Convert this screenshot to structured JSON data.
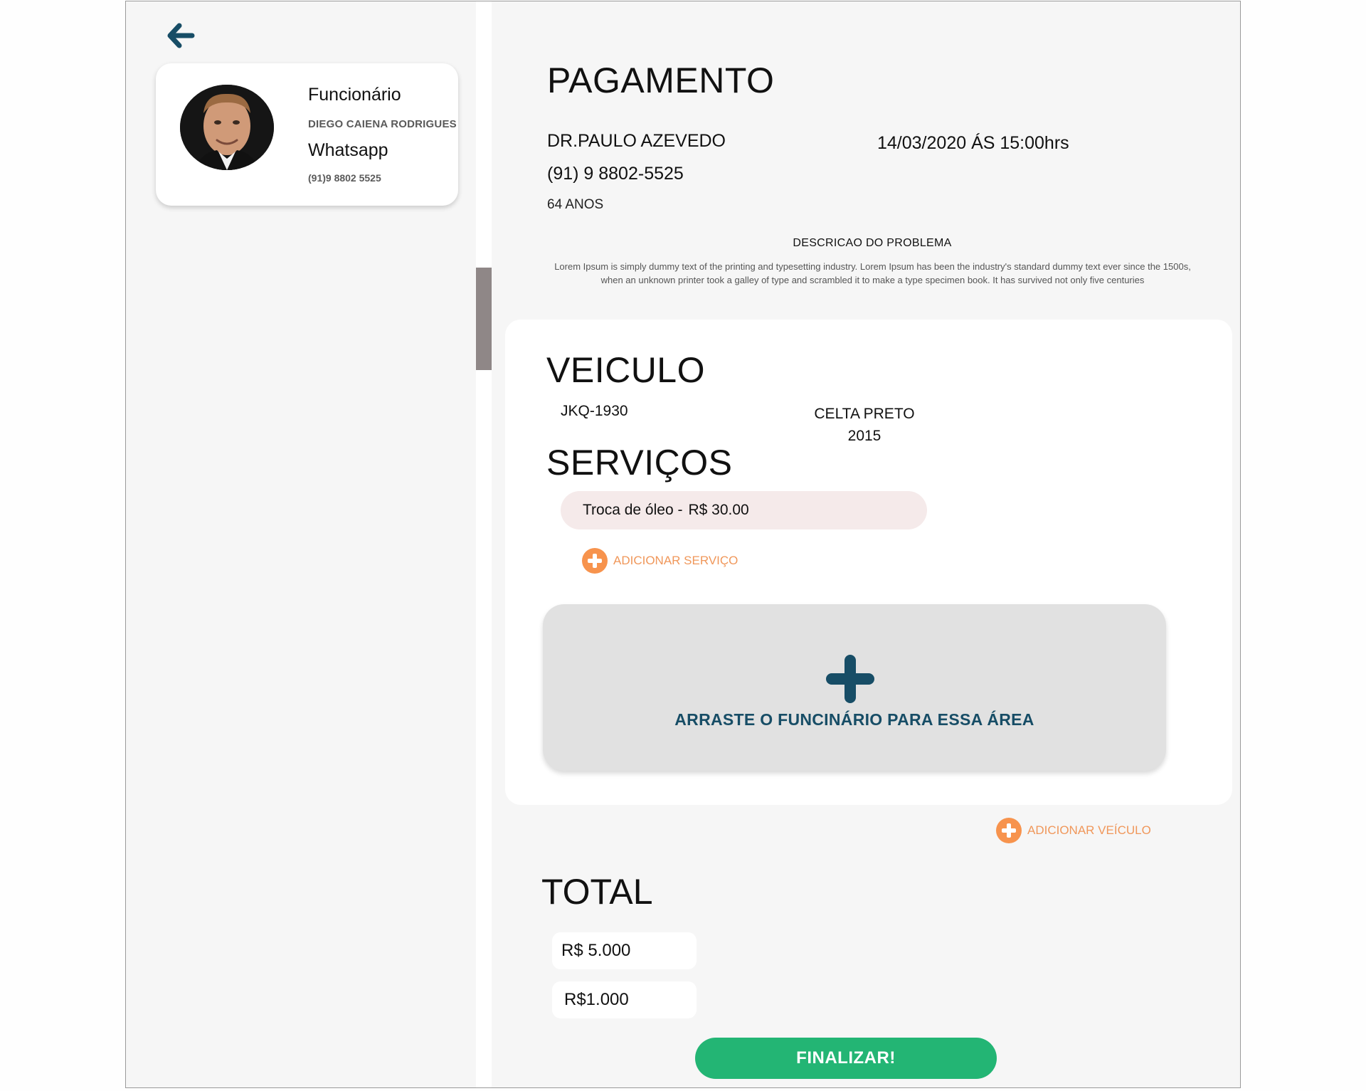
{
  "sidebar": {
    "back_icon": "arrow-left-icon",
    "employee": {
      "role_label": "Funcionário",
      "name": "DIEGO CAIENA RODRIGUES",
      "whatsapp_label": "Whatsapp",
      "phone": "(91)9 8802 5525"
    }
  },
  "payment": {
    "title": "PAGAMENTO",
    "client_name": "DR.PAULO AZEVEDO",
    "client_phone": "(91) 9 8802-5525",
    "client_age": "64 ANOS",
    "datetime": "14/03/2020 ÁS 15:00hrs",
    "problem_title": "DESCRICAO DO PROBLEMA",
    "problem_text": "Lorem Ipsum is simply dummy text of the printing and typesetting industry. Lorem Ipsum has been the industry's standard dummy text ever since the 1500s, when an unknown printer took a galley of type and scrambled it to make a type specimen book. It has survived not only five centuries"
  },
  "vehicle": {
    "title": "VEICULO",
    "plate": "JKQ-1930",
    "model": "CELTA PRETO",
    "year": "2015",
    "services_title": "SERVIÇOS",
    "services": [
      {
        "name": "Troca de óleo -",
        "price": "R$ 30.00"
      }
    ],
    "add_service_label": "ADICIONAR SERVIÇO",
    "drop_zone_label": "ARRASTE O FUNCINÁRIO PARA ESSA ÁREA"
  },
  "add_vehicle_label": "ADICIONAR VEÍCULO",
  "total": {
    "title": "TOTAL",
    "value_1": "R$ 5.000",
    "value_2": "R$1.000"
  },
  "finish_label": "FINALIZAR!",
  "colors": {
    "accent_orange": "#f7934d",
    "primary_dark": "#174d66",
    "finish_green": "#23b574",
    "service_pill": "#f5eaea",
    "drop_zone": "#e1e1e1"
  }
}
